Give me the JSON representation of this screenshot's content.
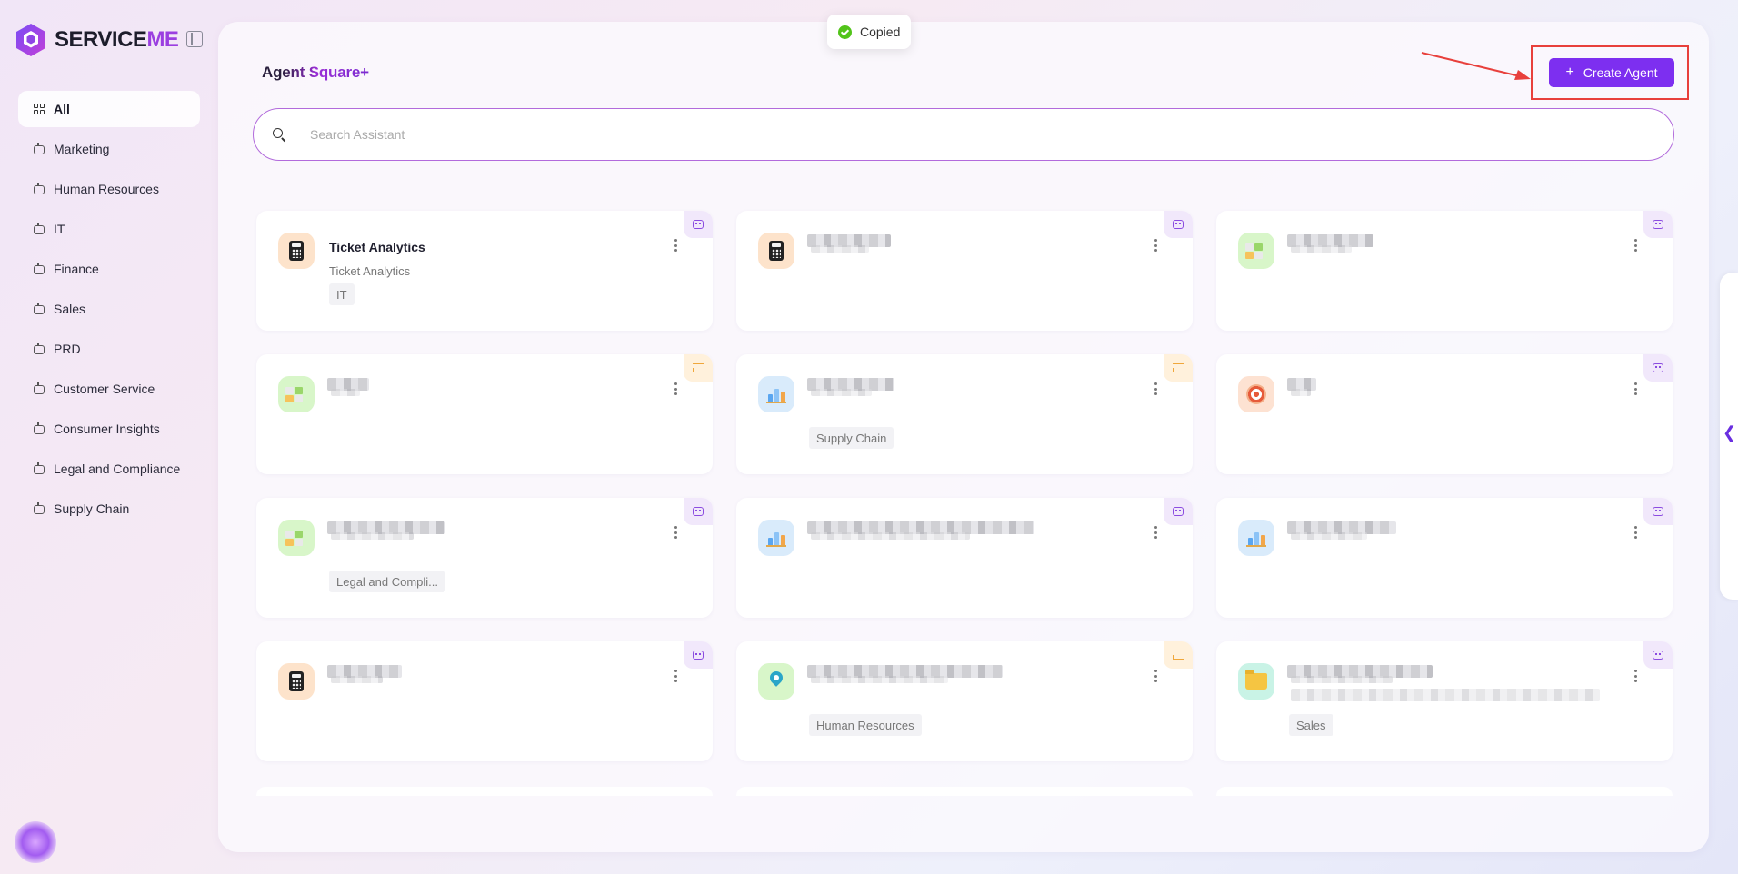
{
  "brand": {
    "name_primary": "SERVICE",
    "name_accent": "ME"
  },
  "sidebar": {
    "items": [
      {
        "label": "All",
        "icon": "grid-icon",
        "active": true
      },
      {
        "label": "Marketing",
        "icon": "bot-icon"
      },
      {
        "label": "Human Resources",
        "icon": "bot-icon"
      },
      {
        "label": "IT",
        "icon": "bot-icon"
      },
      {
        "label": "Finance",
        "icon": "bot-icon"
      },
      {
        "label": "Sales",
        "icon": "bot-icon"
      },
      {
        "label": "PRD",
        "icon": "bot-icon"
      },
      {
        "label": "Customer Service",
        "icon": "bot-icon"
      },
      {
        "label": "Consumer Insights",
        "icon": "bot-icon"
      },
      {
        "label": "Legal and Compliance",
        "icon": "bot-icon"
      },
      {
        "label": "Supply Chain",
        "icon": "bot-icon"
      }
    ]
  },
  "header": {
    "title_start": "Ag",
    "title_end": "ent Square+",
    "create_button_label": "Create Agent",
    "create_button_icon": "+"
  },
  "search": {
    "placeholder": "Search Assistant"
  },
  "toast": {
    "text": "Copied"
  },
  "cards": [
    {
      "title": "Ticket Analytics",
      "subtitle": "Ticket Analytics",
      "tag": "IT",
      "icon": "calculator-icon",
      "badge": "agent-badge-icon"
    },
    {
      "title": "",
      "subtitle": "",
      "tag": "",
      "icon": "calculator-icon",
      "badge": "agent-badge-icon"
    },
    {
      "title": "",
      "subtitle": "",
      "tag": "",
      "icon": "blocks-icon",
      "badge": "agent-badge-icon"
    },
    {
      "title": "",
      "subtitle": "",
      "tag": "",
      "icon": "blocks-icon",
      "badge": "workflow-badge-icon"
    },
    {
      "title": "",
      "subtitle": "",
      "tag": "Supply Chain",
      "icon": "bar-chart-icon",
      "badge": "workflow-badge-icon"
    },
    {
      "title": "",
      "subtitle": "",
      "tag": "",
      "icon": "target-icon",
      "badge": "agent-badge-icon"
    },
    {
      "title": "",
      "subtitle": "",
      "tag": "Legal and Compli...",
      "icon": "blocks-icon",
      "badge": "agent-badge-icon"
    },
    {
      "title": "",
      "subtitle": "",
      "tag": "",
      "icon": "bar-chart-icon",
      "badge": "agent-badge-icon"
    },
    {
      "title": "",
      "subtitle": "",
      "tag": "",
      "icon": "bar-chart-icon",
      "badge": "agent-badge-icon"
    },
    {
      "title": "",
      "subtitle": "",
      "tag": "",
      "icon": "calculator-icon",
      "badge": "agent-badge-icon"
    },
    {
      "title": "",
      "subtitle": "",
      "tag": "Human Resources",
      "icon": "location-pin-icon",
      "badge": "workflow-badge-icon"
    },
    {
      "title": "",
      "subtitle": "",
      "tag": "Sales",
      "icon": "folder-icon",
      "badge": "agent-badge-icon"
    }
  ],
  "side_tab": {
    "glyph": "❮"
  },
  "colors": {
    "accent": "#7d2ff0",
    "highlight_outline": "#e8403c",
    "search_border": "#b26bdc"
  }
}
